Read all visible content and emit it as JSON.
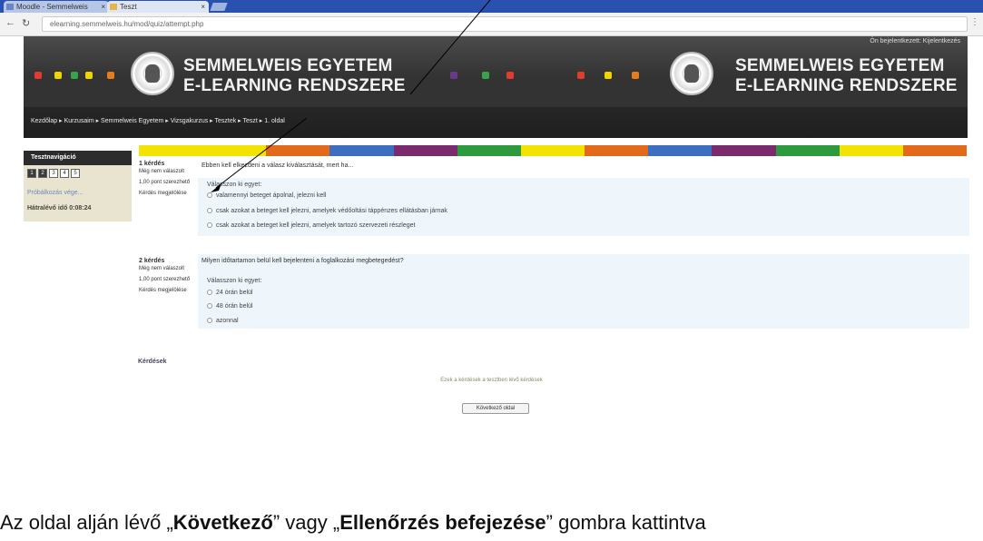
{
  "browser": {
    "tabs": [
      {
        "title": "Moodle - Semmelweis"
      },
      {
        "title": "Teszt"
      }
    ],
    "url": "elearning.semmelweis.hu/mod/quiz/attempt.php"
  },
  "header": {
    "brand_left": [
      "SEMMELWEIS EGYETEM",
      "E-LEARNING RENDSZERE"
    ],
    "brand_right": [
      "SEMMELWEIS EGYETEM",
      "E-LEARNING RENDSZERE"
    ],
    "login_text": "Ön bejelentkezett: Kijelentkezés",
    "breadcrumb": "Kezdőlap ▸ Kurzusaim ▸ Semmelweis Egyetem ▸ Vizsgakurzus ▸ Tesztek ▸ Teszt ▸ 1. oldal"
  },
  "sidebar": {
    "title": "Tesztnavigáció",
    "nav": [
      "1",
      "2",
      "3",
      "4",
      "5"
    ],
    "finish_link": "Próbálkozás vége...",
    "timer": "Hátralévő idő 0:08:24"
  },
  "colors": {
    "strip": [
      "#f2e300",
      "#f2e300",
      "#e36a1b",
      "#3c6fbf",
      "#7b2a6d",
      "#2e9a3e",
      "#f2e300",
      "#e36a1b",
      "#3c6fbf",
      "#7b2a6d",
      "#2e9a3e",
      "#f2e300",
      "#e36a1b"
    ]
  },
  "questions": [
    {
      "info": [
        "1 kérdés",
        "Még nem válaszolt",
        "1,00 pont szerezhető",
        "Kérdés megjelölése"
      ],
      "text": "Ebben kell elkezdeni a válasz kiválasztását, mert ha...",
      "prompt": "Válasszon ki egyet:",
      "options": [
        "valamennyi beteget ápolnal, jelezni kell",
        "csak azokat a beteget kell jelezni, amelyek védőoltási táppénzes ellátásban járnak",
        "csak azokat a beteget kell jelezni, amelyek tartozó szervezeti részleget"
      ]
    },
    {
      "info": [
        "2 kérdés",
        "Még nem válaszolt",
        "1,00 pont szerezhető",
        "Kérdés megjelölése"
      ],
      "text": "Milyen időtartamon belül kell bejelenteni a foglalkozási megbetegedést?",
      "prompt": "Válasszon ki egyet:",
      "options": [
        "24 órán belül",
        "48 órán belül",
        "azonnal"
      ]
    }
  ],
  "footer": {
    "label": "Kérdések",
    "note": "Ezek a kérdések a tesztben lévő kérdések",
    "next_button": "Következő oldal"
  },
  "caption": {
    "prefix": "Az oldal alján lévő „",
    "bold1": "Következő",
    "mid": "” vagy „",
    "bold2": "Ellenőrzés befejezése",
    "suffix": "” gombra kattintva"
  }
}
